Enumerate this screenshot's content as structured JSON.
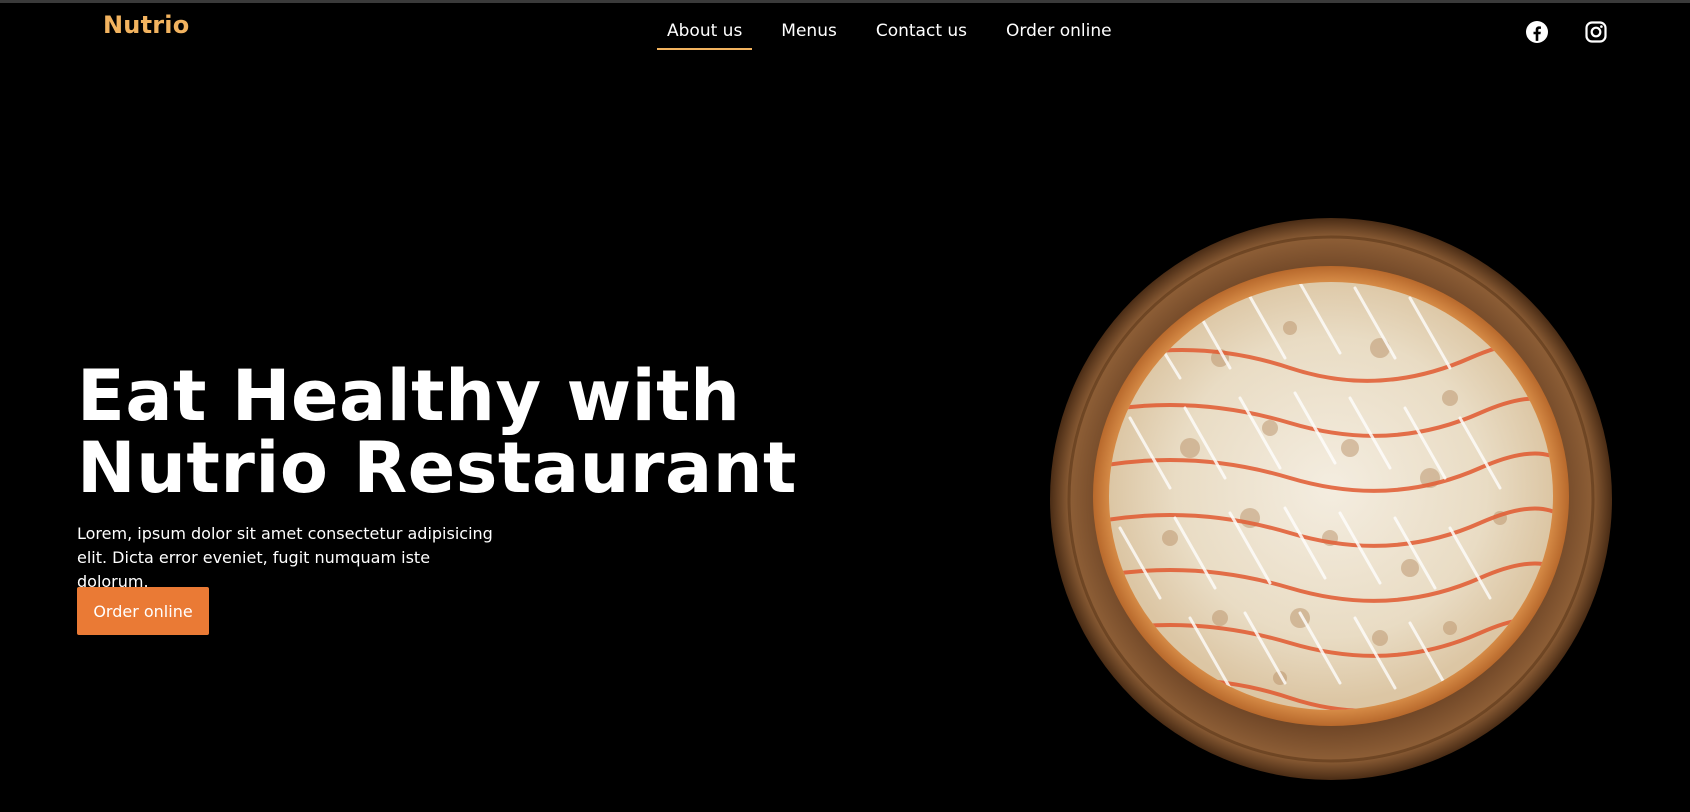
{
  "brand": {
    "name": "Nutrio"
  },
  "nav": {
    "items": [
      {
        "label": "About us",
        "active": true
      },
      {
        "label": "Menus",
        "active": false
      },
      {
        "label": "Contact us",
        "active": false
      },
      {
        "label": "Order online",
        "active": false
      }
    ]
  },
  "social": {
    "icons": [
      "facebook-icon",
      "instagram-icon"
    ]
  },
  "hero": {
    "title_line1": "Eat Healthy with",
    "title_line2": "Nutrio Restaurant",
    "description_line1": "Lorem, ipsum dolor sit amet consectetur adipisicing",
    "description_line2": "elit. Dicta error eveniet, fugit numquam iste dolorum.",
    "cta_label": "Order online",
    "image": "pizza-on-wooden-plate"
  },
  "colors": {
    "background": "#000000",
    "brand": "#f2b35f",
    "accent": "#ea7a35",
    "text": "#ffffff"
  }
}
